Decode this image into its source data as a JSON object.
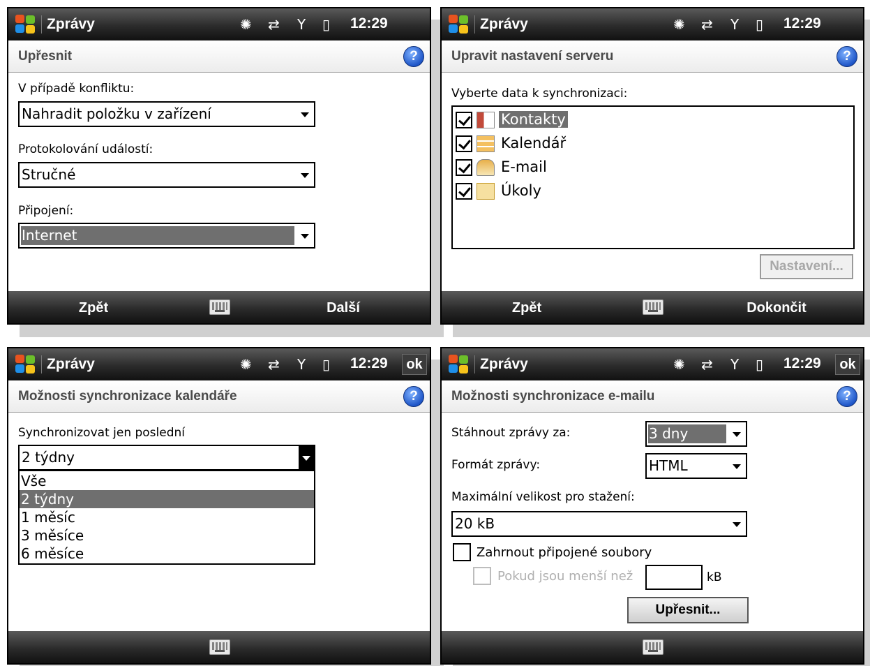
{
  "status": {
    "app_title": "Zprávy",
    "time": "12:29",
    "icons": [
      "windows-start-icon",
      "notification-icon",
      "sync-icon",
      "signal-icon",
      "vibrate-icon"
    ],
    "ok": "ok"
  },
  "p1": {
    "header": "Upřesnit",
    "conflict_label": "V případě konfliktu:",
    "conflict_value": "Nahradit položku v zařízení",
    "logging_label": "Protokolování událostí:",
    "logging_value": "Stručné",
    "connection_label": "Připojení:",
    "connection_value": "Internet",
    "soft_left": "Zpět",
    "soft_right": "Další"
  },
  "p2": {
    "header": "Upravit nastavení serveru",
    "prompt": "Vyberte data k synchronizaci:",
    "items": [
      {
        "label": "Kontakty",
        "checked": true,
        "selected": true,
        "icon": "contacts-icon"
      },
      {
        "label": "Kalendář",
        "checked": true,
        "selected": false,
        "icon": "calendar-icon"
      },
      {
        "label": "E-mail",
        "checked": true,
        "selected": false,
        "icon": "email-icon"
      },
      {
        "label": "Úkoly",
        "checked": true,
        "selected": false,
        "icon": "tasks-icon"
      }
    ],
    "settings_button": "Nastavení...",
    "soft_left": "Zpět",
    "soft_right": "Dokončit"
  },
  "p3": {
    "header": "Možnosti synchronizace kalendáře",
    "sync_label": "Synchronizovat jen poslední",
    "sync_value": "2 týdny",
    "options": [
      "Vše",
      "2 týdny",
      "1 měsíc",
      "3 měsíce",
      "6 měsíce"
    ],
    "selected_option": "2 týdny"
  },
  "p4": {
    "header": "Možnosti synchronizace e-mailu",
    "download_label": "Stáhnout zprávy za:",
    "download_value": "3 dny",
    "format_label": "Formát zprávy:",
    "format_value": "HTML",
    "max_label": "Maximální velikost pro stažení:",
    "max_value": "20 kB",
    "attach_label": "Zahrnout připojené soubory",
    "smaller_label": "Pokud jsou menší než",
    "size_value": "",
    "kb": "kB",
    "advanced_button": "Upřesnit..."
  }
}
